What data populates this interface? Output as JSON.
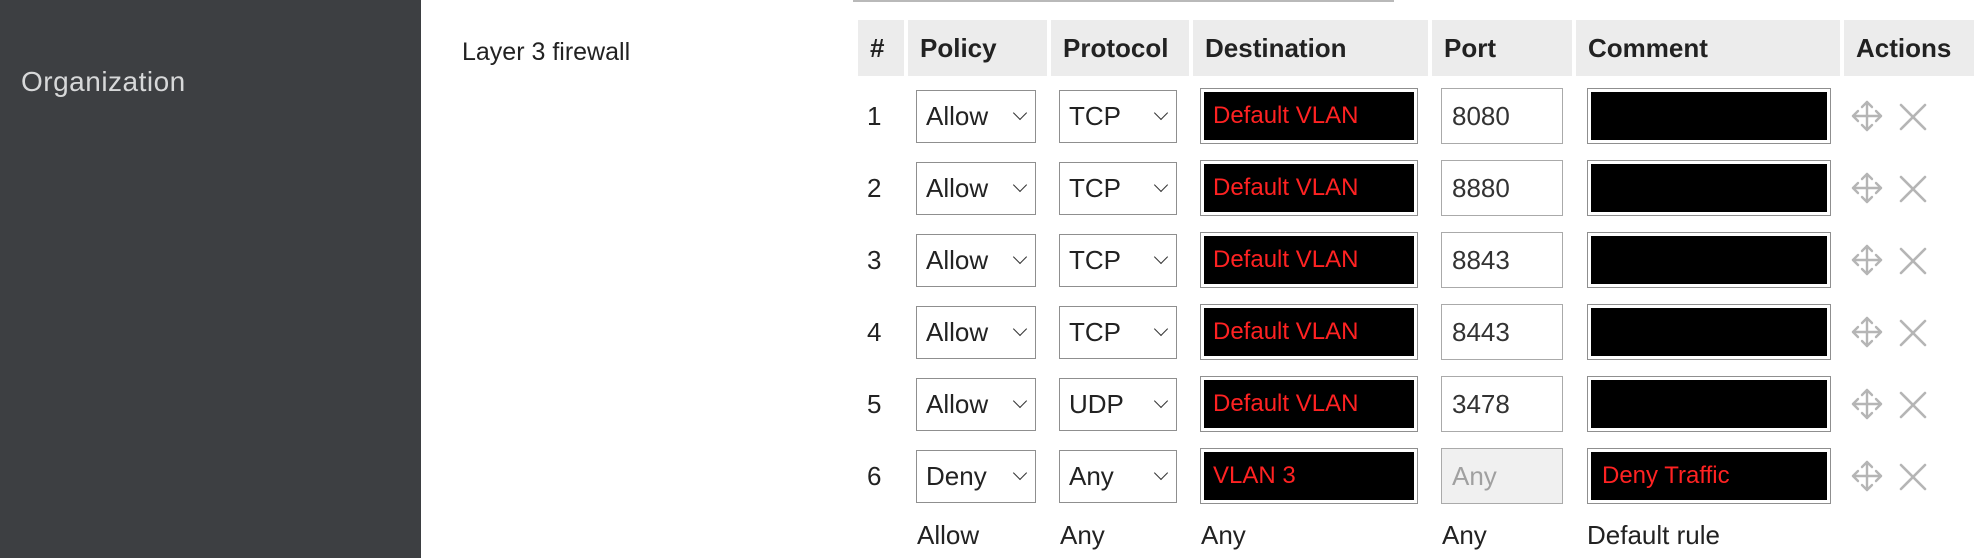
{
  "sidebar": {
    "organization_label": "Organization"
  },
  "section": {
    "title": "Layer 3 firewall"
  },
  "table": {
    "headers": {
      "num": "#",
      "policy": "Policy",
      "protocol": "Protocol",
      "destination": "Destination",
      "port": "Port",
      "comment": "Comment",
      "actions": "Actions"
    },
    "rows": [
      {
        "num": "1",
        "policy": "Allow",
        "protocol": "TCP",
        "destination": "Default VLAN",
        "port": "8080",
        "comment": ""
      },
      {
        "num": "2",
        "policy": "Allow",
        "protocol": "TCP",
        "destination": "Default VLAN",
        "port": "8880",
        "comment": ""
      },
      {
        "num": "3",
        "policy": "Allow",
        "protocol": "TCP",
        "destination": "Default VLAN",
        "port": "8843",
        "comment": ""
      },
      {
        "num": "4",
        "policy": "Allow",
        "protocol": "TCP",
        "destination": "Default VLAN",
        "port": "8443",
        "comment": ""
      },
      {
        "num": "5",
        "policy": "Allow",
        "protocol": "UDP",
        "destination": "Default VLAN",
        "port": "3478",
        "comment": ""
      },
      {
        "num": "6",
        "policy": "Deny",
        "protocol": "Any",
        "destination": "VLAN 3",
        "port_placeholder": "Any",
        "comment": "Deny Traffic"
      }
    ],
    "default_rule": {
      "policy": "Allow",
      "protocol": "Any",
      "destination": "Any",
      "port": "Any",
      "comment": "Default rule"
    }
  },
  "icons": {
    "move": "move-arrows-icon",
    "delete": "close-x-icon"
  },
  "colors": {
    "sidebar_bg": "#3d3f42",
    "header_bg": "#ececec",
    "redaction": "#000000",
    "redaction_text": "#ff2222"
  }
}
